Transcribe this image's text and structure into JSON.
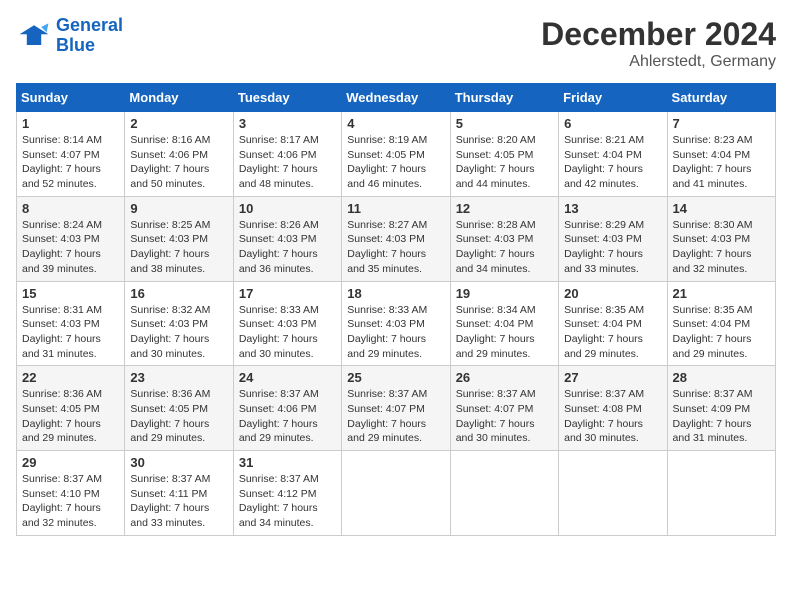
{
  "logo": {
    "line1": "General",
    "line2": "Blue"
  },
  "title": "December 2024",
  "subtitle": "Ahlerstedt, Germany",
  "weekdays": [
    "Sunday",
    "Monday",
    "Tuesday",
    "Wednesday",
    "Thursday",
    "Friday",
    "Saturday"
  ],
  "weeks": [
    [
      {
        "day": "1",
        "sunrise": "8:14 AM",
        "sunset": "4:07 PM",
        "daylight": "7 hours and 52 minutes."
      },
      {
        "day": "2",
        "sunrise": "8:16 AM",
        "sunset": "4:06 PM",
        "daylight": "7 hours and 50 minutes."
      },
      {
        "day": "3",
        "sunrise": "8:17 AM",
        "sunset": "4:06 PM",
        "daylight": "7 hours and 48 minutes."
      },
      {
        "day": "4",
        "sunrise": "8:19 AM",
        "sunset": "4:05 PM",
        "daylight": "7 hours and 46 minutes."
      },
      {
        "day": "5",
        "sunrise": "8:20 AM",
        "sunset": "4:05 PM",
        "daylight": "7 hours and 44 minutes."
      },
      {
        "day": "6",
        "sunrise": "8:21 AM",
        "sunset": "4:04 PM",
        "daylight": "7 hours and 42 minutes."
      },
      {
        "day": "7",
        "sunrise": "8:23 AM",
        "sunset": "4:04 PM",
        "daylight": "7 hours and 41 minutes."
      }
    ],
    [
      {
        "day": "8",
        "sunrise": "8:24 AM",
        "sunset": "4:03 PM",
        "daylight": "7 hours and 39 minutes."
      },
      {
        "day": "9",
        "sunrise": "8:25 AM",
        "sunset": "4:03 PM",
        "daylight": "7 hours and 38 minutes."
      },
      {
        "day": "10",
        "sunrise": "8:26 AM",
        "sunset": "4:03 PM",
        "daylight": "7 hours and 36 minutes."
      },
      {
        "day": "11",
        "sunrise": "8:27 AM",
        "sunset": "4:03 PM",
        "daylight": "7 hours and 35 minutes."
      },
      {
        "day": "12",
        "sunrise": "8:28 AM",
        "sunset": "4:03 PM",
        "daylight": "7 hours and 34 minutes."
      },
      {
        "day": "13",
        "sunrise": "8:29 AM",
        "sunset": "4:03 PM",
        "daylight": "7 hours and 33 minutes."
      },
      {
        "day": "14",
        "sunrise": "8:30 AM",
        "sunset": "4:03 PM",
        "daylight": "7 hours and 32 minutes."
      }
    ],
    [
      {
        "day": "15",
        "sunrise": "8:31 AM",
        "sunset": "4:03 PM",
        "daylight": "7 hours and 31 minutes."
      },
      {
        "day": "16",
        "sunrise": "8:32 AM",
        "sunset": "4:03 PM",
        "daylight": "7 hours and 30 minutes."
      },
      {
        "day": "17",
        "sunrise": "8:33 AM",
        "sunset": "4:03 PM",
        "daylight": "7 hours and 30 minutes."
      },
      {
        "day": "18",
        "sunrise": "8:33 AM",
        "sunset": "4:03 PM",
        "daylight": "7 hours and 29 minutes."
      },
      {
        "day": "19",
        "sunrise": "8:34 AM",
        "sunset": "4:04 PM",
        "daylight": "7 hours and 29 minutes."
      },
      {
        "day": "20",
        "sunrise": "8:35 AM",
        "sunset": "4:04 PM",
        "daylight": "7 hours and 29 minutes."
      },
      {
        "day": "21",
        "sunrise": "8:35 AM",
        "sunset": "4:04 PM",
        "daylight": "7 hours and 29 minutes."
      }
    ],
    [
      {
        "day": "22",
        "sunrise": "8:36 AM",
        "sunset": "4:05 PM",
        "daylight": "7 hours and 29 minutes."
      },
      {
        "day": "23",
        "sunrise": "8:36 AM",
        "sunset": "4:05 PM",
        "daylight": "7 hours and 29 minutes."
      },
      {
        "day": "24",
        "sunrise": "8:37 AM",
        "sunset": "4:06 PM",
        "daylight": "7 hours and 29 minutes."
      },
      {
        "day": "25",
        "sunrise": "8:37 AM",
        "sunset": "4:07 PM",
        "daylight": "7 hours and 29 minutes."
      },
      {
        "day": "26",
        "sunrise": "8:37 AM",
        "sunset": "4:07 PM",
        "daylight": "7 hours and 30 minutes."
      },
      {
        "day": "27",
        "sunrise": "8:37 AM",
        "sunset": "4:08 PM",
        "daylight": "7 hours and 30 minutes."
      },
      {
        "day": "28",
        "sunrise": "8:37 AM",
        "sunset": "4:09 PM",
        "daylight": "7 hours and 31 minutes."
      }
    ],
    [
      {
        "day": "29",
        "sunrise": "8:37 AM",
        "sunset": "4:10 PM",
        "daylight": "7 hours and 32 minutes."
      },
      {
        "day": "30",
        "sunrise": "8:37 AM",
        "sunset": "4:11 PM",
        "daylight": "7 hours and 33 minutes."
      },
      {
        "day": "31",
        "sunrise": "8:37 AM",
        "sunset": "4:12 PM",
        "daylight": "7 hours and 34 minutes."
      },
      null,
      null,
      null,
      null
    ]
  ]
}
